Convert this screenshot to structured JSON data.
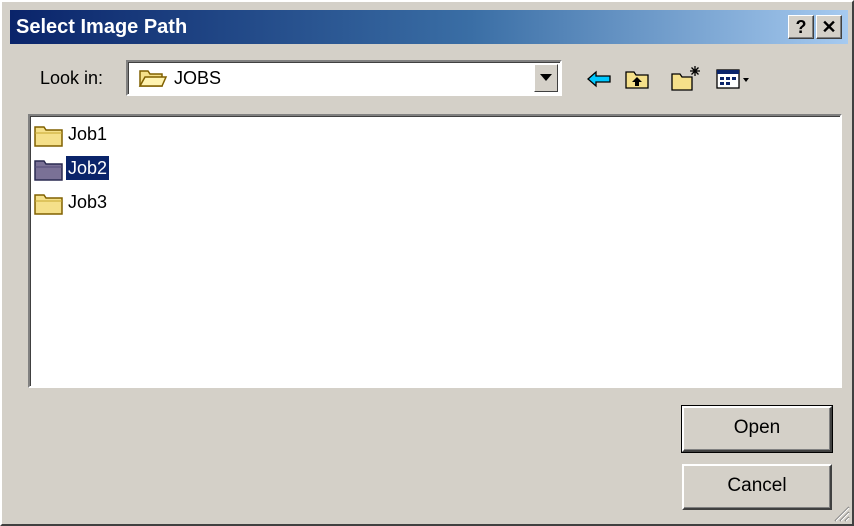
{
  "window": {
    "title": "Select Image Path",
    "help_label": "?",
    "close_label": "✕"
  },
  "lookin": {
    "label": "Look in:",
    "value": "JOBS",
    "icon": "open-folder-icon"
  },
  "toolbar": {
    "items": [
      {
        "name": "back",
        "icon": "back-arrow-icon"
      },
      {
        "name": "up-one-level",
        "icon": "up-folder-icon"
      },
      {
        "name": "create-new-folder",
        "icon": "new-folder-icon"
      },
      {
        "name": "view-menu",
        "icon": "view-menu-icon"
      }
    ]
  },
  "files": {
    "items": [
      {
        "label": "Job1",
        "selected": false
      },
      {
        "label": "Job2",
        "selected": true
      },
      {
        "label": "Job3",
        "selected": false
      }
    ]
  },
  "buttons": {
    "open_label": "Open",
    "cancel_label": "Cancel"
  },
  "colors": {
    "title_start": "#0a246a",
    "title_end": "#a6caf0",
    "face": "#d4d0c8",
    "selection": "#0a246a",
    "folder": "#f5e08a"
  }
}
